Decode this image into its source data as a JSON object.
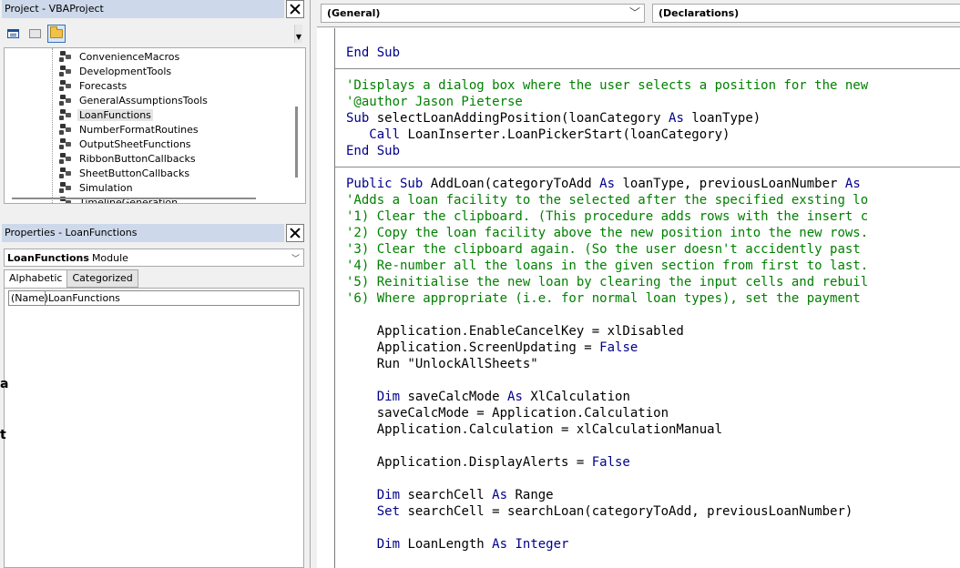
{
  "project_explorer": {
    "title": "Project - VBAProject",
    "modules": [
      {
        "label": "ConvenienceMacros",
        "selected": false
      },
      {
        "label": "DevelopmentTools",
        "selected": false
      },
      {
        "label": "Forecasts",
        "selected": false
      },
      {
        "label": "GeneralAssumptionsTools",
        "selected": false
      },
      {
        "label": "LoanFunctions",
        "selected": true
      },
      {
        "label": "NumberFormatRoutines",
        "selected": false
      },
      {
        "label": "OutputSheetFunctions",
        "selected": false
      },
      {
        "label": "RibbonButtonCallbacks",
        "selected": false
      },
      {
        "label": "SheetButtonCallbacks",
        "selected": false
      },
      {
        "label": "Simulation",
        "selected": false
      },
      {
        "label": "TimelineGeneration",
        "selected": false
      }
    ],
    "toolbar": {
      "view_code_icon": "view-code-icon",
      "view_object_icon": "view-object-icon",
      "toggle_folders_icon": "folder-icon"
    }
  },
  "properties": {
    "title": "Properties - LoanFunctions",
    "object_name": "LoanFunctions",
    "object_type": "Module",
    "tabs": [
      {
        "label": "Alphabetic",
        "active": true
      },
      {
        "label": "Categorized",
        "active": false
      }
    ],
    "rows": [
      {
        "name": "(Name)",
        "value": "LoanFunctions"
      }
    ]
  },
  "left_edge_glyphs": [
    "a",
    "t"
  ],
  "code_window": {
    "object_combo": "(General)",
    "procedure_combo": "(Declarations)",
    "colors": {
      "keyword": "#00008b",
      "comment": "#008000",
      "text": "#000000"
    },
    "lines": [
      [],
      [
        [
          "kw",
          "End Sub"
        ]
      ],
      [],
      [
        [
          "cm",
          "'Displays a dialog box where the user selects a position for the new"
        ]
      ],
      [
        [
          "cm",
          "'@author Jason Pieterse"
        ]
      ],
      [
        [
          "kw",
          "Sub"
        ],
        [
          "tx",
          " selectLoanAddingPosition(loanCategory "
        ],
        [
          "kw",
          "As"
        ],
        [
          "tx",
          " loanType)"
        ]
      ],
      [
        [
          "tx",
          "   "
        ],
        [
          "kw",
          "Call"
        ],
        [
          "tx",
          " LoanInserter.LoanPickerStart(loanCategory)"
        ]
      ],
      [
        [
          "kw",
          "End Sub"
        ]
      ],
      [],
      [
        [
          "kw",
          "Public Sub"
        ],
        [
          "tx",
          " AddLoan(categoryToAdd "
        ],
        [
          "kw",
          "As"
        ],
        [
          "tx",
          " loanType, previousLoanNumber "
        ],
        [
          "kw",
          "As"
        ]
      ],
      [
        [
          "cm",
          "'Adds a loan facility to the selected after the specified exsting lo"
        ]
      ],
      [
        [
          "cm",
          "'1) Clear the clipboard. (This procedure adds rows with the insert c"
        ]
      ],
      [
        [
          "cm",
          "'2) Copy the loan facility above the new position into the new rows."
        ]
      ],
      [
        [
          "cm",
          "'3) Clear the clipboard again. (So the user doesn't accidently past"
        ]
      ],
      [
        [
          "cm",
          "'4) Re-number all the loans in the given section from first to last."
        ]
      ],
      [
        [
          "cm",
          "'5) Reinitialise the new loan by clearing the input cells and rebuil"
        ]
      ],
      [
        [
          "cm",
          "'6) Where appropriate (i.e. for normal loan types), set the payment"
        ]
      ],
      [],
      [
        [
          "tx",
          "    Application.EnableCancelKey = xlDisabled"
        ]
      ],
      [
        [
          "tx",
          "    Application.ScreenUpdating = "
        ],
        [
          "kw",
          "False"
        ]
      ],
      [
        [
          "tx",
          "    Run \"UnlockAllSheets\""
        ]
      ],
      [],
      [
        [
          "tx",
          "    "
        ],
        [
          "kw",
          "Dim"
        ],
        [
          "tx",
          " saveCalcMode "
        ],
        [
          "kw",
          "As"
        ],
        [
          "tx",
          " XlCalculation"
        ]
      ],
      [
        [
          "tx",
          "    saveCalcMode = Application.Calculation"
        ]
      ],
      [
        [
          "tx",
          "    Application.Calculation = xlCalculationManual"
        ]
      ],
      [],
      [
        [
          "tx",
          "    Application.DisplayAlerts = "
        ],
        [
          "kw",
          "False"
        ]
      ],
      [],
      [
        [
          "tx",
          "    "
        ],
        [
          "kw",
          "Dim"
        ],
        [
          "tx",
          " searchCell "
        ],
        [
          "kw",
          "As"
        ],
        [
          "tx",
          " Range"
        ]
      ],
      [
        [
          "tx",
          "    "
        ],
        [
          "kw",
          "Set"
        ],
        [
          "tx",
          " searchCell = searchLoan(categoryToAdd, previousLoanNumber)"
        ]
      ],
      [],
      [
        [
          "tx",
          "    "
        ],
        [
          "kw",
          "Dim"
        ],
        [
          "tx",
          " LoanLength "
        ],
        [
          "kw",
          "As"
        ],
        [
          "tx",
          " "
        ],
        [
          "kw",
          "Integer"
        ]
      ]
    ]
  }
}
